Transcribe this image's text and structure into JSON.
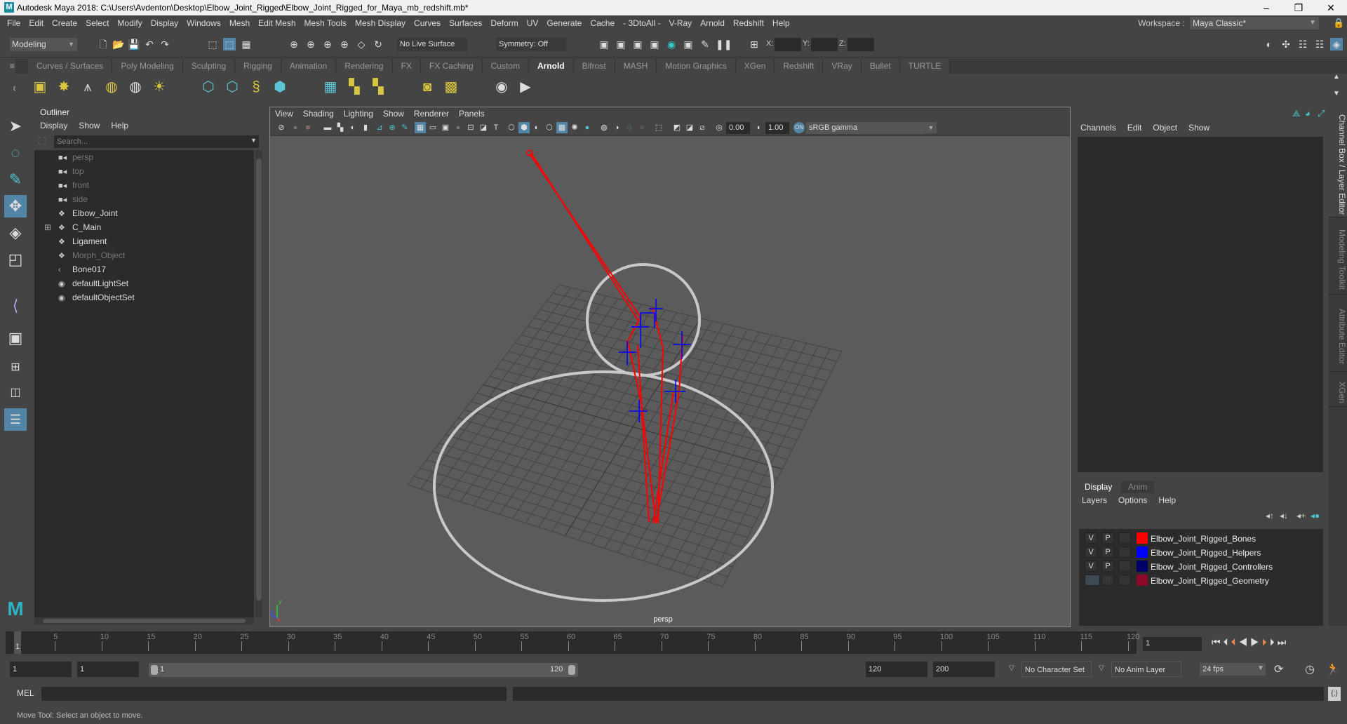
{
  "window": {
    "title": "Autodesk Maya 2018: C:\\Users\\Avdenton\\Desktop\\Elbow_Joint_Rigged\\Elbow_Joint_Rigged_for_Maya_mb_redshift.mb*",
    "minimize": "–",
    "maximize": "❐",
    "close": "✕"
  },
  "menubar": {
    "items": [
      "File",
      "Edit",
      "Create",
      "Select",
      "Modify",
      "Display",
      "Windows",
      "Mesh",
      "Edit Mesh",
      "Mesh Tools",
      "Mesh Display",
      "Curves",
      "Surfaces",
      "Deform",
      "UV",
      "Generate",
      "Cache",
      "- 3DtoAll -",
      "V-Ray",
      "Arnold",
      "Redshift",
      "Help"
    ],
    "workspace_label": "Workspace :",
    "workspace_value": "Maya Classic*"
  },
  "statusline": {
    "mode": "Modeling",
    "live_surface": "No Live Surface",
    "symmetry": "Symmetry: Off",
    "x_label": "X:",
    "y_label": "Y:",
    "z_label": "Z:"
  },
  "shelf": {
    "tabs": [
      "Curves / Surfaces",
      "Poly Modeling",
      "Sculpting",
      "Rigging",
      "Animation",
      "Rendering",
      "FX",
      "FX Caching",
      "Custom",
      "Arnold",
      "Bifrost",
      "MASH",
      "Motion Graphics",
      "XGen",
      "Redshift",
      "VRay",
      "Bullet",
      "TURTLE"
    ],
    "active_tab": "Arnold"
  },
  "outliner": {
    "title": "Outliner",
    "menus": [
      "Display",
      "Show",
      "Help"
    ],
    "search_placeholder": "Search...",
    "items": [
      {
        "label": "persp",
        "icon": "camera-icon",
        "dim": true
      },
      {
        "label": "top",
        "icon": "camera-icon",
        "dim": true
      },
      {
        "label": "front",
        "icon": "camera-icon",
        "dim": true
      },
      {
        "label": "side",
        "icon": "camera-icon",
        "dim": true
      },
      {
        "label": "Elbow_Joint",
        "icon": "group-icon",
        "dim": false
      },
      {
        "label": "C_Main",
        "icon": "group-icon",
        "dim": false,
        "expandable": true
      },
      {
        "label": "Ligament",
        "icon": "group-icon",
        "dim": false
      },
      {
        "label": "Morph_Object",
        "icon": "group-icon",
        "dim": true
      },
      {
        "label": "Bone017",
        "icon": "joint-icon",
        "dim": false
      },
      {
        "label": "defaultLightSet",
        "icon": "set-icon",
        "dim": false
      },
      {
        "label": "defaultObjectSet",
        "icon": "set-icon",
        "dim": false
      }
    ]
  },
  "viewport": {
    "menus": [
      "View",
      "Shading",
      "Lighting",
      "Show",
      "Renderer",
      "Panels"
    ],
    "exposure": "0.00",
    "gamma": "1.00",
    "color_space": "sRGB gamma",
    "camera_label": "persp"
  },
  "channelbox": {
    "menus": [
      "Channels",
      "Edit",
      "Object",
      "Show"
    ]
  },
  "layer_editor": {
    "tabs": [
      "Display",
      "Anim"
    ],
    "active_tab": "Display",
    "menus": [
      "Layers",
      "Options",
      "Help"
    ],
    "layers": [
      {
        "v": "V",
        "p": "P",
        "name": "Elbow_Joint_Rigged_Bones",
        "color": "#ff0000"
      },
      {
        "v": "V",
        "p": "P",
        "name": "Elbow_Joint_Rigged_Helpers",
        "color": "#0000ff"
      },
      {
        "v": "V",
        "p": "P",
        "name": "Elbow_Joint_Rigged_Controllers",
        "color": "#000066"
      },
      {
        "v": "",
        "p": "P",
        "name": "Elbow_Joint_Rigged_Geometry",
        "color": "#8b0a2a"
      }
    ]
  },
  "side_tabs": [
    "Channel Box / Layer Editor",
    "Modeling Toolkit",
    "Attribute Editor",
    "XGen"
  ],
  "timeline": {
    "ticks": [
      "5",
      "10",
      "15",
      "20",
      "25",
      "30",
      "35",
      "40",
      "45",
      "50",
      "55",
      "60",
      "65",
      "70",
      "75",
      "80",
      "85",
      "90",
      "95",
      "100",
      "105",
      "110",
      "115",
      "120"
    ],
    "current_frame_marker": "1",
    "current_frame": "1"
  },
  "range": {
    "start": "1",
    "anim_start": "1",
    "slider_min": "1",
    "slider_max": "120",
    "end": "120",
    "anim_end": "200",
    "character_set": "No Character Set",
    "anim_layer": "No Anim Layer",
    "fps": "24 fps"
  },
  "command_line": {
    "label": "MEL"
  },
  "help_line": "Move Tool: Select an object to move."
}
